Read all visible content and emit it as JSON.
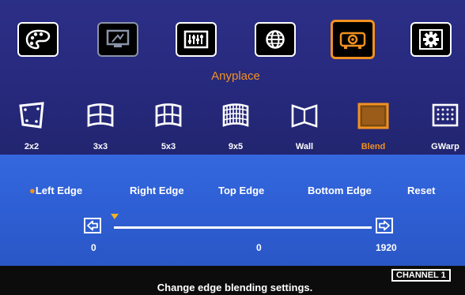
{
  "top_menu": {
    "title": "Anyplace",
    "items": [
      {
        "icon": "palette-icon",
        "state": "normal"
      },
      {
        "icon": "monitor-settings-icon",
        "state": "dimmed"
      },
      {
        "icon": "equalizer-icon",
        "state": "normal"
      },
      {
        "icon": "globe-icon",
        "state": "normal"
      },
      {
        "icon": "projector-icon",
        "state": "selected"
      },
      {
        "icon": "gear-icon",
        "state": "normal"
      }
    ]
  },
  "sub_menu": {
    "items": [
      {
        "label": "2x2",
        "icon": "warp-2x2-icon"
      },
      {
        "label": "3x3",
        "icon": "warp-3x3-icon"
      },
      {
        "label": "5x3",
        "icon": "warp-5x3-icon"
      },
      {
        "label": "9x5",
        "icon": "warp-9x5-icon"
      },
      {
        "label": "Wall",
        "icon": "wall-icon"
      },
      {
        "label": "Blend",
        "icon": "blend-icon",
        "selected": true
      },
      {
        "label": "GWarp",
        "icon": "gwarp-icon"
      }
    ]
  },
  "blend_panel": {
    "options": [
      "Left Edge",
      "Right Edge",
      "Top Edge",
      "Bottom Edge",
      "Reset"
    ],
    "selected_option": "Left Edge",
    "bullet": "●",
    "slider": {
      "min": "0",
      "value": "0",
      "max": "1920"
    }
  },
  "footer": {
    "hint": "Change edge blending settings.",
    "channel": "CHANNEL 1"
  },
  "colors": {
    "accent": "#f19120",
    "top_bg": "#2a2d80",
    "panel_bg": "#2f60d6",
    "marker": "#f2b320"
  }
}
